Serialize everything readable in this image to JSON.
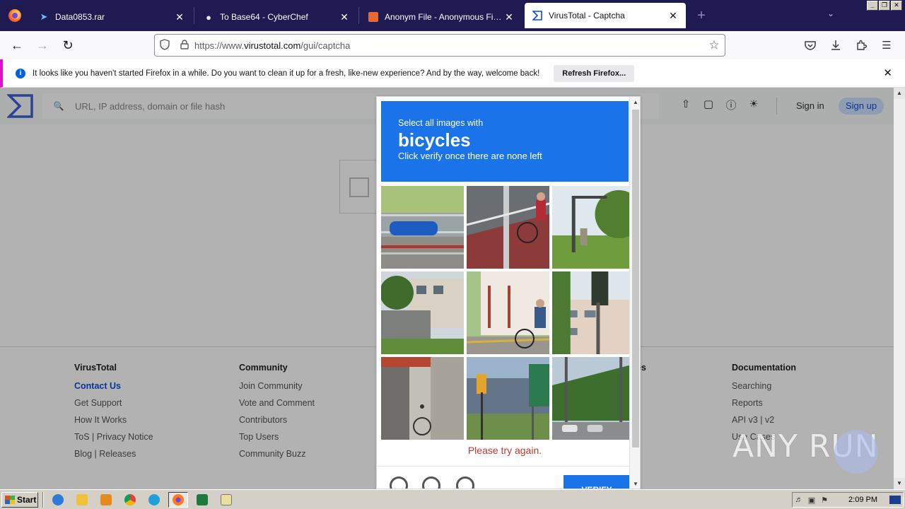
{
  "browser": {
    "tabs": [
      {
        "title": "Data0853.rar",
        "icon": "file-icon",
        "active": false
      },
      {
        "title": "To Base64 - CyberChef",
        "icon": "chef-icon",
        "active": false
      },
      {
        "title": "Anonym File - Anonymous File Uplo",
        "icon": "anonym-icon",
        "active": false
      },
      {
        "title": "VirusTotal - Captcha",
        "icon": "virustotal-icon",
        "active": true
      }
    ],
    "new_tab": "+",
    "url": "https://www.virustotal.com/gui/captcha",
    "url_host": "virustotal.com",
    "url_prefix": "https://www.",
    "url_suffix": "/gui/captcha"
  },
  "notification": {
    "text": "It looks like you haven't started Firefox in a while. Do you want to clean it up for a fresh, like-new experience? And by the way, welcome back!",
    "button": "Refresh Firefox..."
  },
  "virustotal": {
    "search_placeholder": "URL, IP address, domain or file hash",
    "sign_in": "Sign in",
    "sign_up": "Sign up",
    "footer": {
      "columns": [
        {
          "title": "VirusTotal",
          "links": [
            "Contact Us",
            "Get Support",
            "How It Works",
            "ToS | Privacy Notice",
            "Blog | Releases"
          ]
        },
        {
          "title": "Community",
          "links": [
            "Join Community",
            "Vote and Comment",
            "Contributors",
            "Top Users",
            "Community Buzz"
          ]
        },
        {
          "title": "Documentation",
          "links": [
            "Searching",
            "Reports",
            "API v3 | v2",
            "Use Cases"
          ]
        }
      ],
      "partial_heading": "es"
    }
  },
  "challenge": {
    "line1": "Select all images with",
    "keyword": "bicycles",
    "line3": "Click verify once there are none left",
    "error": "Please try again.",
    "verify": "VERIFY"
  },
  "watermark": "ANY RUN",
  "taskbar": {
    "start": "Start",
    "clock": "2:09 PM"
  },
  "colors": {
    "prompt_blue": "#1a73e8",
    "tab_bar": "#1f1a52",
    "error_red": "#c0392b"
  }
}
